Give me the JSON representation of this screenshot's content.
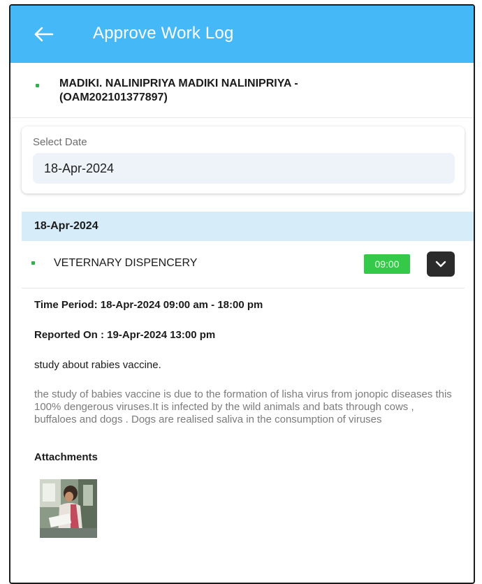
{
  "app_bar": {
    "title": "Approve Work Log",
    "bg_color": "#45b8f8"
  },
  "employee": {
    "name": "MADIKI. NALINIPRIYA MADIKI NALINIPRIYA - (OAM202101377897)"
  },
  "date_picker": {
    "label": "Select Date",
    "value": "18-Apr-2024"
  },
  "day": {
    "date": "18-Apr-2024",
    "entry": {
      "name": "VETERNARY DISPENCERY",
      "hours": "09:00",
      "badge_color": "#35c94a",
      "expand_icon": "chevron-down-icon"
    }
  },
  "details": {
    "time_period": "Time Period: 18-Apr-2024 09:00 am - 18:00 pm",
    "reported_on": "Reported On : 19-Apr-2024 13:00 pm",
    "subject": "study about rabies vaccine.",
    "description": "the study of babies vaccine is due to the formation of lisha virus from jonopic diseases this 100% dengerous viruses.It is infected by the wild animals and bats through cows , buffaloes and dogs . Dogs are realised saliva in the consumption of viruses",
    "attachments_label": "Attachments",
    "attachments": [
      {
        "type": "image",
        "icon": "photo-thumbnail"
      }
    ]
  }
}
